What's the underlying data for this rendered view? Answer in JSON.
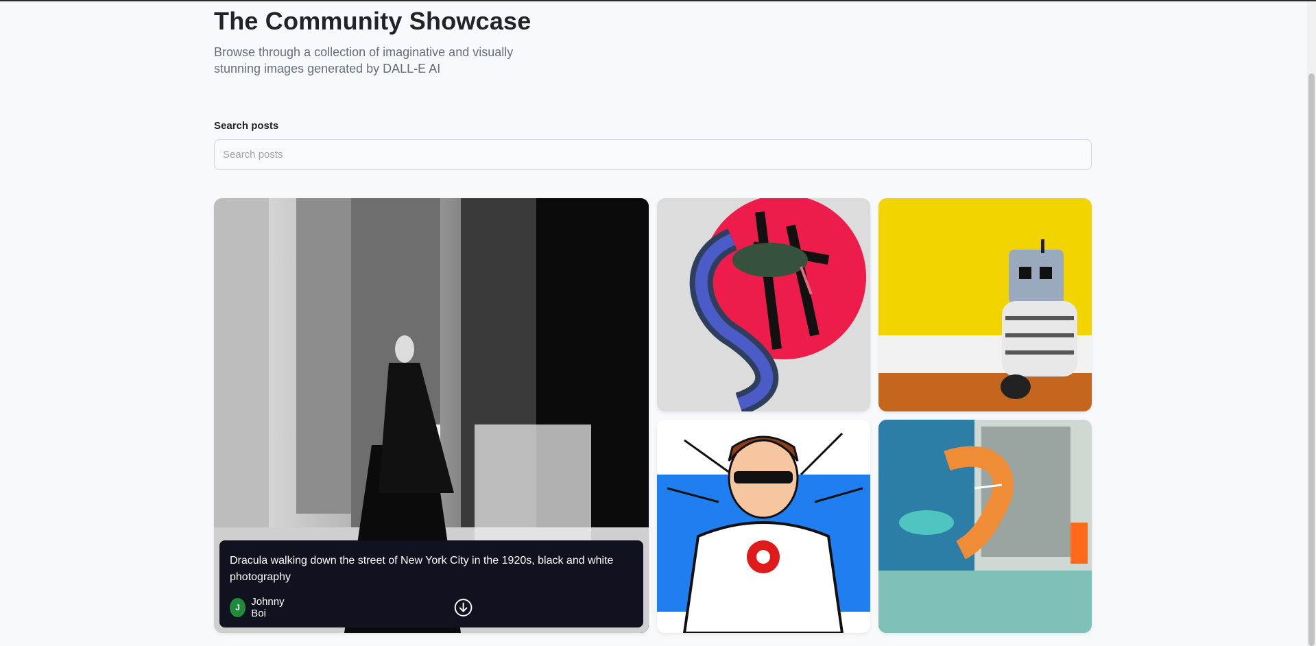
{
  "header": {
    "title": "The Community Showcase",
    "subtitle": "Browse through a collection of imaginative and visually stunning images generated by DALL-E AI"
  },
  "search": {
    "label": "Search posts",
    "placeholder": "Search posts",
    "value": ""
  },
  "posts": [
    {
      "prompt": "Dracula walking down the street of New York City in the 1920s, black and white photography",
      "author": "Johnny Boi",
      "avatar_letter": "J",
      "avatar_color": "#1f8a3a"
    }
  ],
  "icons": {
    "download": "download-icon"
  }
}
